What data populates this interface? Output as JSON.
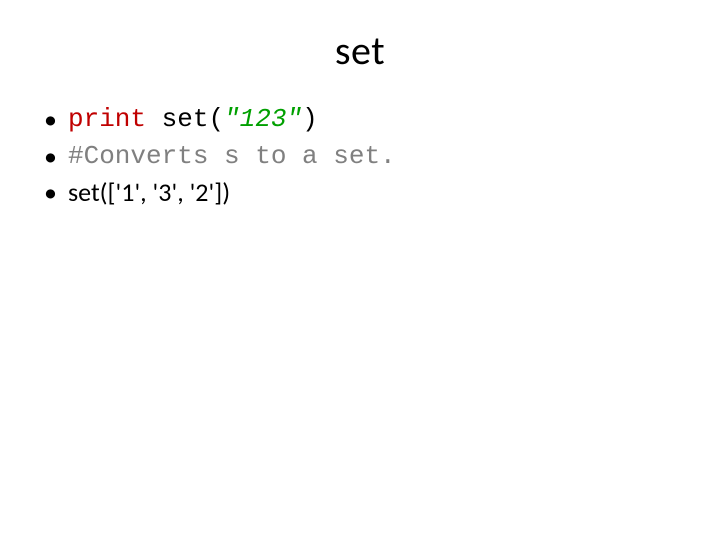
{
  "slide": {
    "title": "set",
    "bullets": [
      {
        "kind": "code",
        "keyword": "print",
        "space1": " ",
        "func": "set",
        "lparen": "(",
        "string": "\"123\"",
        "rparen": ")"
      },
      {
        "kind": "comment",
        "text": "#Converts s to a set."
      },
      {
        "kind": "output",
        "text": "set(['1', '3', '2'])"
      }
    ]
  }
}
